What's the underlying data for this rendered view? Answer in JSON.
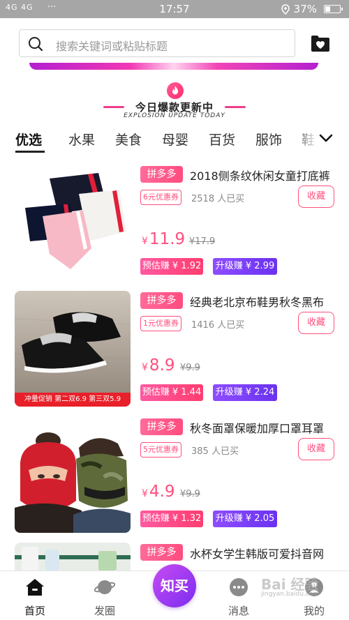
{
  "status_bar": {
    "network": "4G 4G",
    "dots": "···",
    "time": "17:57",
    "battery": "37%",
    "battery_level": 0.37
  },
  "header": {
    "search_placeholder": "搜索关键词或粘贴标题"
  },
  "hot_section": {
    "title": "今日爆款更新中",
    "subtitle": "EXPLOSION UPDATE TODAY"
  },
  "tabs": [
    "优选",
    "水果",
    "美食",
    "母婴",
    "百货",
    "服饰",
    "鞋"
  ],
  "products": [
    {
      "badge": "拼多多",
      "title": "2018侧条纹休闲女童打底裤",
      "coupon": "6元优惠券",
      "sold": "2518 人已买",
      "collect": "收藏",
      "currency": "¥",
      "price": "11.9",
      "original_price": "¥17.9",
      "estimate": "预估赚 ¥ 1.92",
      "upgrade": "升级赚 ¥ 2.99",
      "promo": ""
    },
    {
      "badge": "拼多多",
      "title": "经典老北京布鞋男秋冬黑布",
      "coupon": "1元优惠券",
      "sold": "1416 人已买",
      "collect": "收藏",
      "currency": "¥",
      "price": "8.9",
      "original_price": "¥9.9",
      "estimate": "预估赚 ¥ 1.44",
      "upgrade": "升级赚 ¥ 2.24",
      "promo": "冲量促销  第二双6.9  第三双5.9"
    },
    {
      "badge": "拼多多",
      "title": "秋冬面罩保暖加厚口罩耳罩",
      "coupon": "5元优惠券",
      "sold": "385 人已买",
      "collect": "收藏",
      "currency": "¥",
      "price": "4.9",
      "original_price": "¥9.9",
      "estimate": "预估赚 ¥ 1.32",
      "upgrade": "升级赚 ¥ 2.05",
      "promo": ""
    },
    {
      "badge": "拼多多",
      "title": "水杯女学生韩版可爱抖音网",
      "coupon": "",
      "sold": "",
      "collect": "",
      "currency": "",
      "price": "",
      "original_price": "",
      "estimate": "",
      "upgrade": "",
      "promo": ""
    }
  ],
  "bottom_nav": {
    "home": "首页",
    "moments": "发圈",
    "center": "知买",
    "messages": "消息",
    "mine": "我的"
  },
  "watermark": {
    "text": "Bai  经验",
    "sub": "jingyan.baidu.com"
  },
  "colors": {
    "accent_pink": "#ff4f7d",
    "accent_purple": "#7b2df0",
    "status_bar": "#a6a6a6"
  }
}
